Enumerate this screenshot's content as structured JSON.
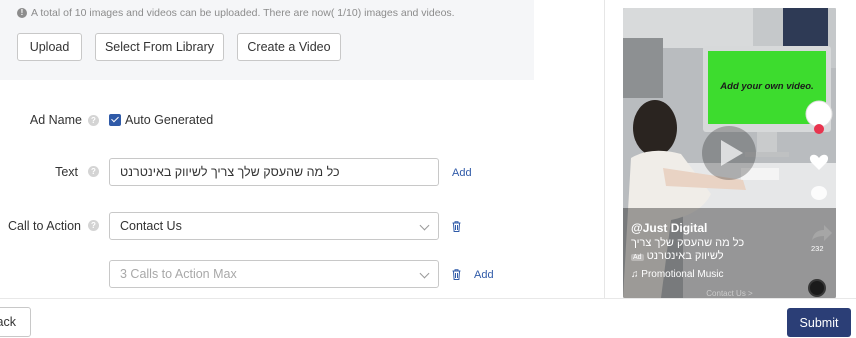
{
  "upload": {
    "notice": "A total of 10 images and videos can be uploaded. There are now( 1/10) images and videos.",
    "buttons": {
      "upload": "Upload",
      "library": "Select From Library",
      "create_video": "Create a Video"
    }
  },
  "form": {
    "ad_name": {
      "label": "Ad Name",
      "auto_generated_label": "Auto Generated",
      "auto_generated_checked": true
    },
    "text": {
      "label": "Text",
      "value": "כל מה שהעסק שלך צריך לשיווק באינטרנט",
      "add_link": "Add"
    },
    "cta": {
      "label": "Call to Action",
      "value": "Contact Us",
      "placeholder": "3 Calls to Action Max",
      "add_link": "Add"
    }
  },
  "preview": {
    "screen_text": "Add your own video.",
    "account": "@Just Digital",
    "caption": "כל מה שהעסק שלך צריך לשיווק באינטרנט",
    "ad_badge": "Ad",
    "music": "♫ Promotional Music",
    "share_count": "232",
    "cta": "Contact Us >"
  },
  "footer": {
    "back_label": "ack",
    "submit_label": "Submit"
  },
  "colors": {
    "accent": "#2f5aa8",
    "submit_bg": "#2b3e76",
    "screen_green": "#3ddc2e",
    "panel_bg": "#f5f6f8"
  },
  "icons": [
    "info-icon",
    "help-icon",
    "checkbox-checked-icon",
    "chevron-down-icon",
    "trash-icon",
    "play-icon",
    "heart-icon",
    "comment-icon",
    "share-icon",
    "music-disc-icon"
  ]
}
